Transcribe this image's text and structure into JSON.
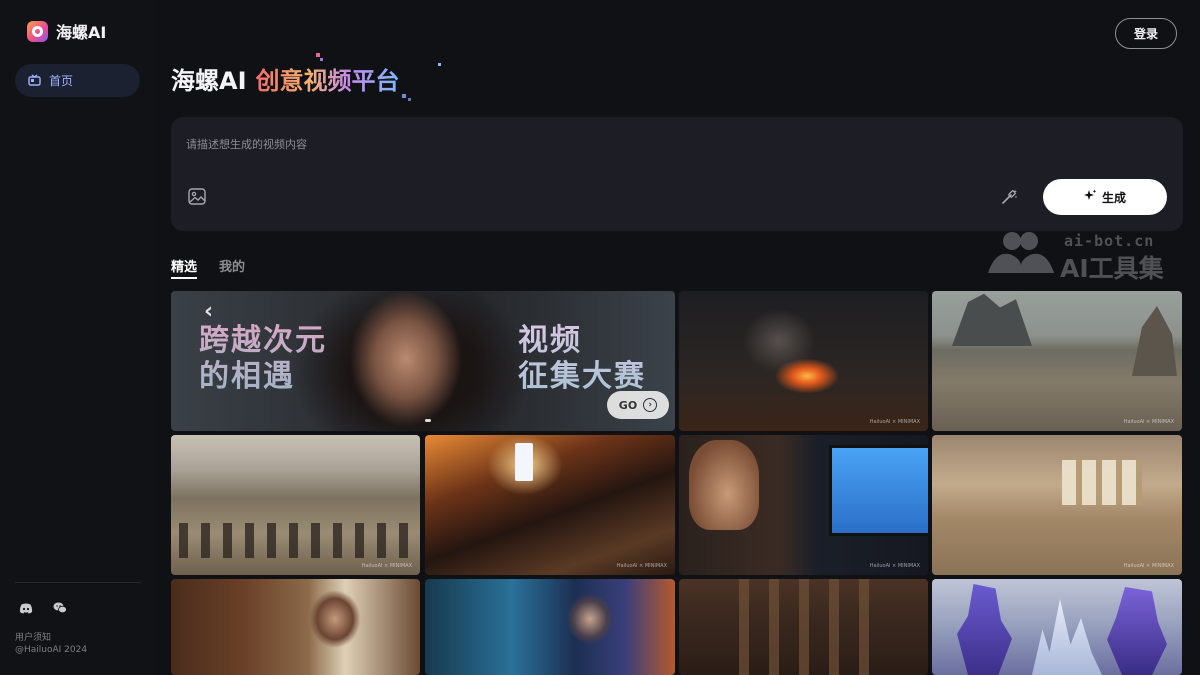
{
  "brand": {
    "name": "海螺AI"
  },
  "sidebar": {
    "home_label": "首页",
    "footer_line1": "用户须知",
    "footer_line2": "@HailuoAI 2024"
  },
  "header": {
    "login_label": "登录"
  },
  "hero": {
    "title_white": "海螺AI",
    "title_gradient": "创意视频平台"
  },
  "prompt": {
    "placeholder": "请描述想生成的视频内容",
    "generate_label": "生成"
  },
  "tabs": [
    {
      "label": "精选",
      "active": true
    },
    {
      "label": "我的",
      "active": false
    }
  ],
  "watermark": {
    "line1": "ai-bot.cn",
    "line2": "AI工具集"
  },
  "banner": {
    "left_text_1": "跨越次元",
    "left_text_2": "的相遇",
    "right_text_1": "视频",
    "right_text_2": "征集大赛",
    "go_label": "GO"
  },
  "tiles": [
    {
      "name": "fire-scene",
      "watermark": "HailuoAI × MINIMAX"
    },
    {
      "name": "desert-creature",
      "watermark": "HailuoAI × MINIMAX"
    },
    {
      "name": "cavalry-charge",
      "watermark": "HailuoAI × MINIMAX"
    },
    {
      "name": "city-night",
      "watermark": "HailuoAI × MINIMAX"
    },
    {
      "name": "boy-gaming",
      "watermark": "HailuoAI × MINIMAX"
    },
    {
      "name": "palace-room",
      "watermark": "HailuoAI × MINIMAX"
    },
    {
      "name": "man-in-study",
      "watermark": ""
    },
    {
      "name": "crystal-cave",
      "watermark": ""
    },
    {
      "name": "grand-hall",
      "watermark": ""
    },
    {
      "name": "mech-robots",
      "watermark": ""
    }
  ],
  "colors": {
    "background": "#101114",
    "accent_nav": "#9fb3ff",
    "prompt_box": "#1c1d25"
  },
  "icons": [
    "home-icon",
    "discord-icon",
    "wechat-icon",
    "image-icon",
    "magic-wand-icon",
    "sparkle-icon",
    "arrow-circle-icon"
  ]
}
